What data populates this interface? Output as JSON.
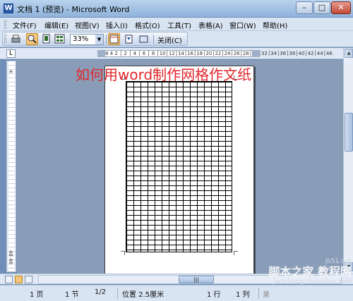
{
  "window": {
    "title": "文档 1 (预览) - Microsoft Word",
    "icon": "word-app-icon",
    "minimize_glyph": "–",
    "maximize_glyph": "□",
    "close_glyph": "✕"
  },
  "menu": {
    "items": [
      "文件(F)",
      "编辑(E)",
      "视图(V)",
      "插入(I)",
      "格式(O)",
      "工具(T)",
      "表格(A)",
      "窗口(W)",
      "帮助(H)"
    ]
  },
  "toolbar": {
    "zoom": "33%",
    "zoom_arrow": "▼",
    "close_preview": "关闭(C)"
  },
  "ruler": {
    "tab_selector": "L",
    "ticks": "8  4 2 │ 2 │ 4 │ 6 │ 8 │10│12│14│16│18│20│22│24│26│28│30│32│34│36│38│40│42│44│46",
    "tick_end": "4446",
    "vertical_top": "4",
    "vertical_bottom": "48 46"
  },
  "document": {
    "overlay_title": "如何用word制作网格作文纸",
    "overlay_color": "#e0262b"
  },
  "scroll": {
    "up": "▲",
    "down": "▼",
    "hthumb": "|||"
  },
  "status": {
    "page": "1 页",
    "section": "1 节",
    "pages": "1/2",
    "position": "位置 2.5厘米",
    "line": "1 行",
    "column": "1 列",
    "record": "录"
  },
  "watermark": {
    "site": "jb51.net",
    "main": "脚本之家  教程网",
    "url": "jiaocheng.chazidian.com"
  }
}
